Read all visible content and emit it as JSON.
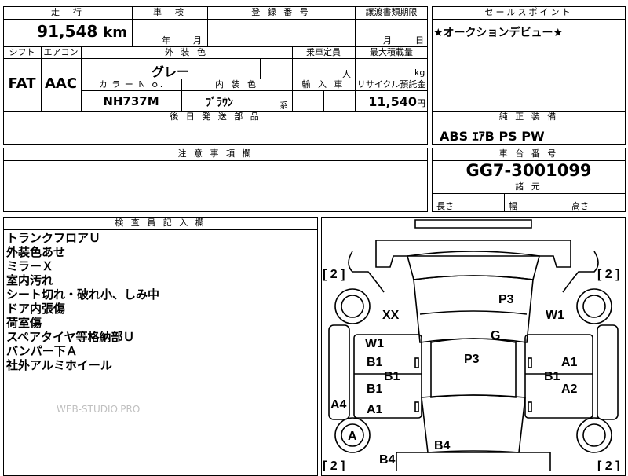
{
  "top": {
    "mileage_header": "走　行",
    "mileage_value": "91,548",
    "mileage_unit": "km",
    "inspection_header": "車　検",
    "inspection_year": "年",
    "inspection_month": "月",
    "registration_header": "登 録 番 号",
    "transfer_header": "譲渡書類期限",
    "transfer_month": "月",
    "transfer_day": "日"
  },
  "row2": {
    "shift_header": "シフト",
    "shift_value": "FAT",
    "ac_header": "エアコン",
    "ac_value": "AAC",
    "ext_color_header": "外 装 色",
    "ext_color_value": "グレー",
    "capacity_header": "乗車定員",
    "capacity_unit": "人",
    "max_load_header": "最大積載量",
    "max_load_unit": "kg",
    "color_no_header": "カ ラ ー Ｎ ｏ.",
    "color_no_value": "NH737M",
    "interior_header": "内 装 色",
    "interior_value": "ﾌﾞﾗｳﾝ",
    "interior_suffix": "系",
    "import_header": "輸 入 車",
    "recycle_header": "リサイクル預託金",
    "recycle_value": "11,540",
    "recycle_unit": "円",
    "later_parts_header": "後 日 発 送 部 品"
  },
  "sales_point": {
    "header": "セールスポイント",
    "text": "★オークションデビュー★"
  },
  "standard_equipment": {
    "header": "純 正 装 備",
    "value": "ABS ｴｱB PS PW"
  },
  "notes": {
    "header": "注 意 事 項 欄"
  },
  "chassis": {
    "header": "車 台 番 号",
    "value": "GG7-3001099",
    "dims_header": "諸 元",
    "length_label": "長さ",
    "width_label": "幅",
    "height_label": "高さ"
  },
  "inspector": {
    "header": "検 査 員 記 入 欄",
    "lines": [
      "トランクフロアＵ",
      "外装色あせ",
      "ミラーＸ",
      "室内汚れ",
      "シート切れ・破れ小、しみ中",
      "ドア内張傷",
      "荷室傷",
      "スペアタイヤ等格納部Ｕ",
      "バンパー下Ａ",
      "社外アルミホイール"
    ],
    "watermark": "WEB-STUDIO.PRO"
  },
  "diagram": {
    "tire_tl": "[ 2 ]",
    "tire_tr": "[ 2 ]",
    "tire_bl": "[ 2 ]",
    "tire_br": "[ 2 ]",
    "marks": {
      "p3_top": "P3",
      "xx": "XX",
      "w1_right": "W1",
      "w1_left": "W1",
      "g": "G",
      "b1_left_upper": "B1",
      "p3_center": "P3",
      "a1_right": "A1",
      "b1_left_center": "B1",
      "b1_right_center": "B1",
      "b1_left_lower": "B1",
      "a2_right": "A2",
      "a4_left": "A4",
      "a1_left": "A1",
      "a_front": "A",
      "b4_center": "B4",
      "b4_left": "B4"
    }
  }
}
